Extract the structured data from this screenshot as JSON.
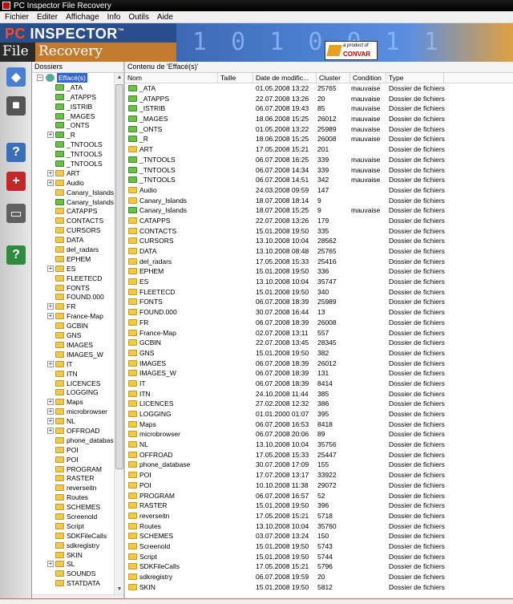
{
  "window": {
    "title": "PC Inspector File Recovery"
  },
  "menu": [
    "Fichier",
    "Editer",
    "Affichage",
    "Info",
    "Outils",
    "Aide"
  ],
  "banner": {
    "logo_top_pc": "PC",
    "logo_top_rest": " INSPECTOR",
    "tm": "™",
    "logo_file": "File",
    "logo_recovery": "Recovery",
    "binary_digits": "1 0 1 0 0 1 1",
    "vendor_prefix": "a product of",
    "vendor_name": "CONVAR"
  },
  "toolbar": {
    "buttons": [
      {
        "name": "open-drive-button",
        "icon": "drive-icon",
        "color": "#4a7fd0",
        "glyph": "◆"
      },
      {
        "name": "save-button",
        "icon": "floppy-icon",
        "color": "#555555",
        "glyph": "■"
      },
      {
        "name": "search-button",
        "icon": "search-icon",
        "color": "#3a6fb8",
        "glyph": "?"
      },
      {
        "name": "recover-button",
        "icon": "recover-icon",
        "color": "#c0282a",
        "glyph": "+"
      },
      {
        "name": "drive-button",
        "icon": "harddisk-icon",
        "color": "#606060",
        "glyph": "▭"
      },
      {
        "name": "help-button",
        "icon": "help-icon",
        "color": "#2e8a3e",
        "glyph": "?"
      }
    ]
  },
  "tree": {
    "header": "Dossiers",
    "root": "Effacé(s)",
    "items": [
      {
        "label": "_ATA",
        "green": true,
        "expandable": false
      },
      {
        "label": "_ATAPPS",
        "green": true,
        "expandable": false
      },
      {
        "label": "_ISTRIB",
        "green": true,
        "expandable": false
      },
      {
        "label": "_MAGES",
        "green": true,
        "expandable": false
      },
      {
        "label": "_ONTS",
        "green": true,
        "expandable": false
      },
      {
        "label": "_R",
        "green": true,
        "expandable": true
      },
      {
        "label": "_TNTOOLS",
        "green": true,
        "expandable": false
      },
      {
        "label": "_TNTOOLS",
        "green": true,
        "expandable": false
      },
      {
        "label": "_TNTOOLS",
        "green": true,
        "expandable": false
      },
      {
        "label": "ART",
        "green": false,
        "expandable": true
      },
      {
        "label": "Audio",
        "green": false,
        "expandable": true
      },
      {
        "label": "Canary_Islands",
        "green": false,
        "expandable": false
      },
      {
        "label": "Canary_Islands",
        "green": true,
        "expandable": false
      },
      {
        "label": "CATAPPS",
        "green": false,
        "expandable": false
      },
      {
        "label": "CONTACTS",
        "green": false,
        "expandable": false
      },
      {
        "label": "CURSORS",
        "green": false,
        "expandable": false
      },
      {
        "label": "DATA",
        "green": false,
        "expandable": false
      },
      {
        "label": "del_radars",
        "green": false,
        "expandable": false
      },
      {
        "label": "EPHEM",
        "green": false,
        "expandable": false
      },
      {
        "label": "ES",
        "green": false,
        "expandable": true
      },
      {
        "label": "FLEETECD",
        "green": false,
        "expandable": false
      },
      {
        "label": "FONTS",
        "green": false,
        "expandable": false
      },
      {
        "label": "FOUND.000",
        "green": false,
        "expandable": false
      },
      {
        "label": "FR",
        "green": false,
        "expandable": true
      },
      {
        "label": "France-Map",
        "green": false,
        "expandable": true
      },
      {
        "label": "GCBIN",
        "green": false,
        "expandable": false
      },
      {
        "label": "GNS",
        "green": false,
        "expandable": false
      },
      {
        "label": "IMAGES",
        "green": false,
        "expandable": false
      },
      {
        "label": "IMAGES_W",
        "green": false,
        "expandable": false
      },
      {
        "label": "IT",
        "green": false,
        "expandable": true
      },
      {
        "label": "ITN",
        "green": false,
        "expandable": false
      },
      {
        "label": "LICENCES",
        "green": false,
        "expandable": false
      },
      {
        "label": "LOGGING",
        "green": false,
        "expandable": false
      },
      {
        "label": "Maps",
        "green": false,
        "expandable": true
      },
      {
        "label": "microbrowser",
        "green": false,
        "expandable": true
      },
      {
        "label": "NL",
        "green": false,
        "expandable": true
      },
      {
        "label": "OFFROAD",
        "green": false,
        "expandable": true
      },
      {
        "label": "phone_databas",
        "green": false,
        "expandable": false
      },
      {
        "label": "POI",
        "green": false,
        "expandable": false
      },
      {
        "label": "POI",
        "green": false,
        "expandable": false
      },
      {
        "label": "PROGRAM",
        "green": false,
        "expandable": false
      },
      {
        "label": "RASTER",
        "green": false,
        "expandable": false
      },
      {
        "label": "reverseitn",
        "green": false,
        "expandable": false
      },
      {
        "label": "Routes",
        "green": false,
        "expandable": false
      },
      {
        "label": "SCHEMES",
        "green": false,
        "expandable": false
      },
      {
        "label": "Screenold",
        "green": false,
        "expandable": false
      },
      {
        "label": "Script",
        "green": false,
        "expandable": false
      },
      {
        "label": "SDKFileCalls",
        "green": false,
        "expandable": false
      },
      {
        "label": "sdkregistry",
        "green": false,
        "expandable": false
      },
      {
        "label": "SKIN",
        "green": false,
        "expandable": false
      },
      {
        "label": "SL",
        "green": false,
        "expandable": true
      },
      {
        "label": "SOUNDS",
        "green": false,
        "expandable": false
      },
      {
        "label": "STATDATA",
        "green": false,
        "expandable": false
      }
    ]
  },
  "list": {
    "header": "Contenu de 'Effacé(s)'",
    "columns": [
      "Nom",
      "Taille",
      "Date de modific...",
      "Cluster",
      "Condition",
      "Type"
    ],
    "rows": [
      {
        "name": "_ATA",
        "green": true,
        "size": "",
        "date": "01.05.2008 13:22",
        "cluster": "25765",
        "condition": "mauvaise",
        "type": "Dossier de fichiers"
      },
      {
        "name": "_ATAPPS",
        "green": true,
        "size": "",
        "date": "22.07.2008 13:26",
        "cluster": "20",
        "condition": "mauvaise",
        "type": "Dossier de fichiers"
      },
      {
        "name": "_ISTRIB",
        "green": true,
        "size": "",
        "date": "06.07.2008 19:43",
        "cluster": "85",
        "condition": "mauvaise",
        "type": "Dossier de fichiers"
      },
      {
        "name": "_MAGES",
        "green": true,
        "size": "",
        "date": "18.06.2008 15:25",
        "cluster": "26012",
        "condition": "mauvaise",
        "type": "Dossier de fichiers"
      },
      {
        "name": "_ONTS",
        "green": true,
        "size": "",
        "date": "01.05.2008 13:22",
        "cluster": "25989",
        "condition": "mauvaise",
        "type": "Dossier de fichiers"
      },
      {
        "name": "_R",
        "green": true,
        "size": "",
        "date": "18.06.2008 15:25",
        "cluster": "26008",
        "condition": "mauvaise",
        "type": "Dossier de fichiers"
      },
      {
        "name": "ART",
        "green": false,
        "size": "",
        "date": "17.05.2008 15:21",
        "cluster": "201",
        "condition": "",
        "type": "Dossier de fichiers"
      },
      {
        "name": "_TNTOOLS",
        "green": true,
        "size": "",
        "date": "06.07.2008 16:25",
        "cluster": "339",
        "condition": "mauvaise",
        "type": "Dossier de fichiers"
      },
      {
        "name": "_TNTOOLS",
        "green": true,
        "size": "",
        "date": "06.07.2008 14:34",
        "cluster": "339",
        "condition": "mauvaise",
        "type": "Dossier de fichiers"
      },
      {
        "name": "_TNTOOLS",
        "green": true,
        "size": "",
        "date": "06.07.2008 14:51",
        "cluster": "342",
        "condition": "mauvaise",
        "type": "Dossier de fichiers"
      },
      {
        "name": "Audio",
        "green": false,
        "size": "",
        "date": "24.03.2008 09:59",
        "cluster": "147",
        "condition": "",
        "type": "Dossier de fichiers"
      },
      {
        "name": "Canary_Islands",
        "green": false,
        "size": "",
        "date": "18.07.2008 18:14",
        "cluster": "9",
        "condition": "",
        "type": "Dossier de fichiers"
      },
      {
        "name": "Canary_Islands",
        "green": true,
        "size": "",
        "date": "18.07.2008 15:25",
        "cluster": "9",
        "condition": "mauvaise",
        "type": "Dossier de fichiers"
      },
      {
        "name": "CATAPPS",
        "green": false,
        "size": "",
        "date": "22.07.2008 13:26",
        "cluster": "179",
        "condition": "",
        "type": "Dossier de fichiers"
      },
      {
        "name": "CONTACTS",
        "green": false,
        "size": "",
        "date": "15.01.2008 19:50",
        "cluster": "335",
        "condition": "",
        "type": "Dossier de fichiers"
      },
      {
        "name": "CURSORS",
        "green": false,
        "size": "",
        "date": "13.10.2008 10:04",
        "cluster": "28562",
        "condition": "",
        "type": "Dossier de fichiers"
      },
      {
        "name": "DATA",
        "green": false,
        "size": "",
        "date": "13.10.2008 08:48",
        "cluster": "25765",
        "condition": "",
        "type": "Dossier de fichiers"
      },
      {
        "name": "del_radars",
        "green": false,
        "size": "",
        "date": "17.05.2008 15:33",
        "cluster": "25416",
        "condition": "",
        "type": "Dossier de fichiers"
      },
      {
        "name": "EPHEM",
        "green": false,
        "size": "",
        "date": "15.01.2008 19:50",
        "cluster": "336",
        "condition": "",
        "type": "Dossier de fichiers"
      },
      {
        "name": "ES",
        "green": false,
        "size": "",
        "date": "13.10.2008 10:04",
        "cluster": "35747",
        "condition": "",
        "type": "Dossier de fichiers"
      },
      {
        "name": "FLEETECD",
        "green": false,
        "size": "",
        "date": "15.01.2008 19:50",
        "cluster": "340",
        "condition": "",
        "type": "Dossier de fichiers"
      },
      {
        "name": "FONTS",
        "green": false,
        "size": "",
        "date": "06.07.2008 18:39",
        "cluster": "25989",
        "condition": "",
        "type": "Dossier de fichiers"
      },
      {
        "name": "FOUND.000",
        "green": false,
        "size": "",
        "date": "30.07.2008 16:44",
        "cluster": "13",
        "condition": "",
        "type": "Dossier de fichiers"
      },
      {
        "name": "FR",
        "green": false,
        "size": "",
        "date": "06.07.2008 18:39",
        "cluster": "26008",
        "condition": "",
        "type": "Dossier de fichiers"
      },
      {
        "name": "France-Map",
        "green": false,
        "size": "",
        "date": "02.07.2008 13:11",
        "cluster": "557",
        "condition": "",
        "type": "Dossier de fichiers"
      },
      {
        "name": "GCBIN",
        "green": false,
        "size": "",
        "date": "22.07.2008 13:45",
        "cluster": "28345",
        "condition": "",
        "type": "Dossier de fichiers"
      },
      {
        "name": "GNS",
        "green": false,
        "size": "",
        "date": "15.01.2008 19:50",
        "cluster": "382",
        "condition": "",
        "type": "Dossier de fichiers"
      },
      {
        "name": "IMAGES",
        "green": false,
        "size": "",
        "date": "06.07.2008 18:39",
        "cluster": "26012",
        "condition": "",
        "type": "Dossier de fichiers"
      },
      {
        "name": "IMAGES_W",
        "green": false,
        "size": "",
        "date": "06.07.2008 18:39",
        "cluster": "131",
        "condition": "",
        "type": "Dossier de fichiers"
      },
      {
        "name": "IT",
        "green": false,
        "size": "",
        "date": "06.07.2008 18:39",
        "cluster": "8414",
        "condition": "",
        "type": "Dossier de fichiers"
      },
      {
        "name": "ITN",
        "green": false,
        "size": "",
        "date": "24.10.2008 11:44",
        "cluster": "385",
        "condition": "",
        "type": "Dossier de fichiers"
      },
      {
        "name": "LICENCES",
        "green": false,
        "size": "",
        "date": "27.02.2008 12:32",
        "cluster": "386",
        "condition": "",
        "type": "Dossier de fichiers"
      },
      {
        "name": "LOGGING",
        "green": false,
        "size": "",
        "date": "01.01.2000 01:07",
        "cluster": "395",
        "condition": "",
        "type": "Dossier de fichiers"
      },
      {
        "name": "Maps",
        "green": false,
        "size": "",
        "date": "06.07.2008 16:53",
        "cluster": "8418",
        "condition": "",
        "type": "Dossier de fichiers"
      },
      {
        "name": "microbrowser",
        "green": false,
        "size": "",
        "date": "06.07.2008 20:06",
        "cluster": "89",
        "condition": "",
        "type": "Dossier de fichiers"
      },
      {
        "name": "NL",
        "green": false,
        "size": "",
        "date": "13.10.2008 10:04",
        "cluster": "35756",
        "condition": "",
        "type": "Dossier de fichiers"
      },
      {
        "name": "OFFROAD",
        "green": false,
        "size": "",
        "date": "17.05.2008 15:33",
        "cluster": "25447",
        "condition": "",
        "type": "Dossier de fichiers"
      },
      {
        "name": "phone_database",
        "green": false,
        "size": "",
        "date": "30.07.2008 17:09",
        "cluster": "155",
        "condition": "",
        "type": "Dossier de fichiers"
      },
      {
        "name": "POI",
        "green": false,
        "size": "",
        "date": "17.07.2008 13:17",
        "cluster": "33922",
        "condition": "",
        "type": "Dossier de fichiers"
      },
      {
        "name": "POI",
        "green": false,
        "size": "",
        "date": "10.10.2008 11:38",
        "cluster": "29072",
        "condition": "",
        "type": "Dossier de fichiers"
      },
      {
        "name": "PROGRAM",
        "green": false,
        "size": "",
        "date": "06.07.2008 16:57",
        "cluster": "52",
        "condition": "",
        "type": "Dossier de fichiers"
      },
      {
        "name": "RASTER",
        "green": false,
        "size": "",
        "date": "15.01.2008 19:50",
        "cluster": "396",
        "condition": "",
        "type": "Dossier de fichiers"
      },
      {
        "name": "reverseitn",
        "green": false,
        "size": "",
        "date": "17.05.2008 15:21",
        "cluster": "5718",
        "condition": "",
        "type": "Dossier de fichiers"
      },
      {
        "name": "Routes",
        "green": false,
        "size": "",
        "date": "13.10.2008 10:04",
        "cluster": "35760",
        "condition": "",
        "type": "Dossier de fichiers"
      },
      {
        "name": "SCHEMES",
        "green": false,
        "size": "",
        "date": "03.07.2008 13:24",
        "cluster": "150",
        "condition": "",
        "type": "Dossier de fichiers"
      },
      {
        "name": "Screenold",
        "green": false,
        "size": "",
        "date": "15.01.2008 19:50",
        "cluster": "5743",
        "condition": "",
        "type": "Dossier de fichiers"
      },
      {
        "name": "Script",
        "green": false,
        "size": "",
        "date": "15.01.2008 19:50",
        "cluster": "5744",
        "condition": "",
        "type": "Dossier de fichiers"
      },
      {
        "name": "SDKFileCalls",
        "green": false,
        "size": "",
        "date": "17.05.2008 15:21",
        "cluster": "5796",
        "condition": "",
        "type": "Dossier de fichiers"
      },
      {
        "name": "sdkregistry",
        "green": false,
        "size": "",
        "date": "06.07.2008 19:59",
        "cluster": "20",
        "condition": "",
        "type": "Dossier de fichiers"
      },
      {
        "name": "SKIN",
        "green": false,
        "size": "",
        "date": "15.01.2008 19:50",
        "cluster": "5812",
        "condition": "",
        "type": "Dossier de fichiers"
      }
    ]
  }
}
